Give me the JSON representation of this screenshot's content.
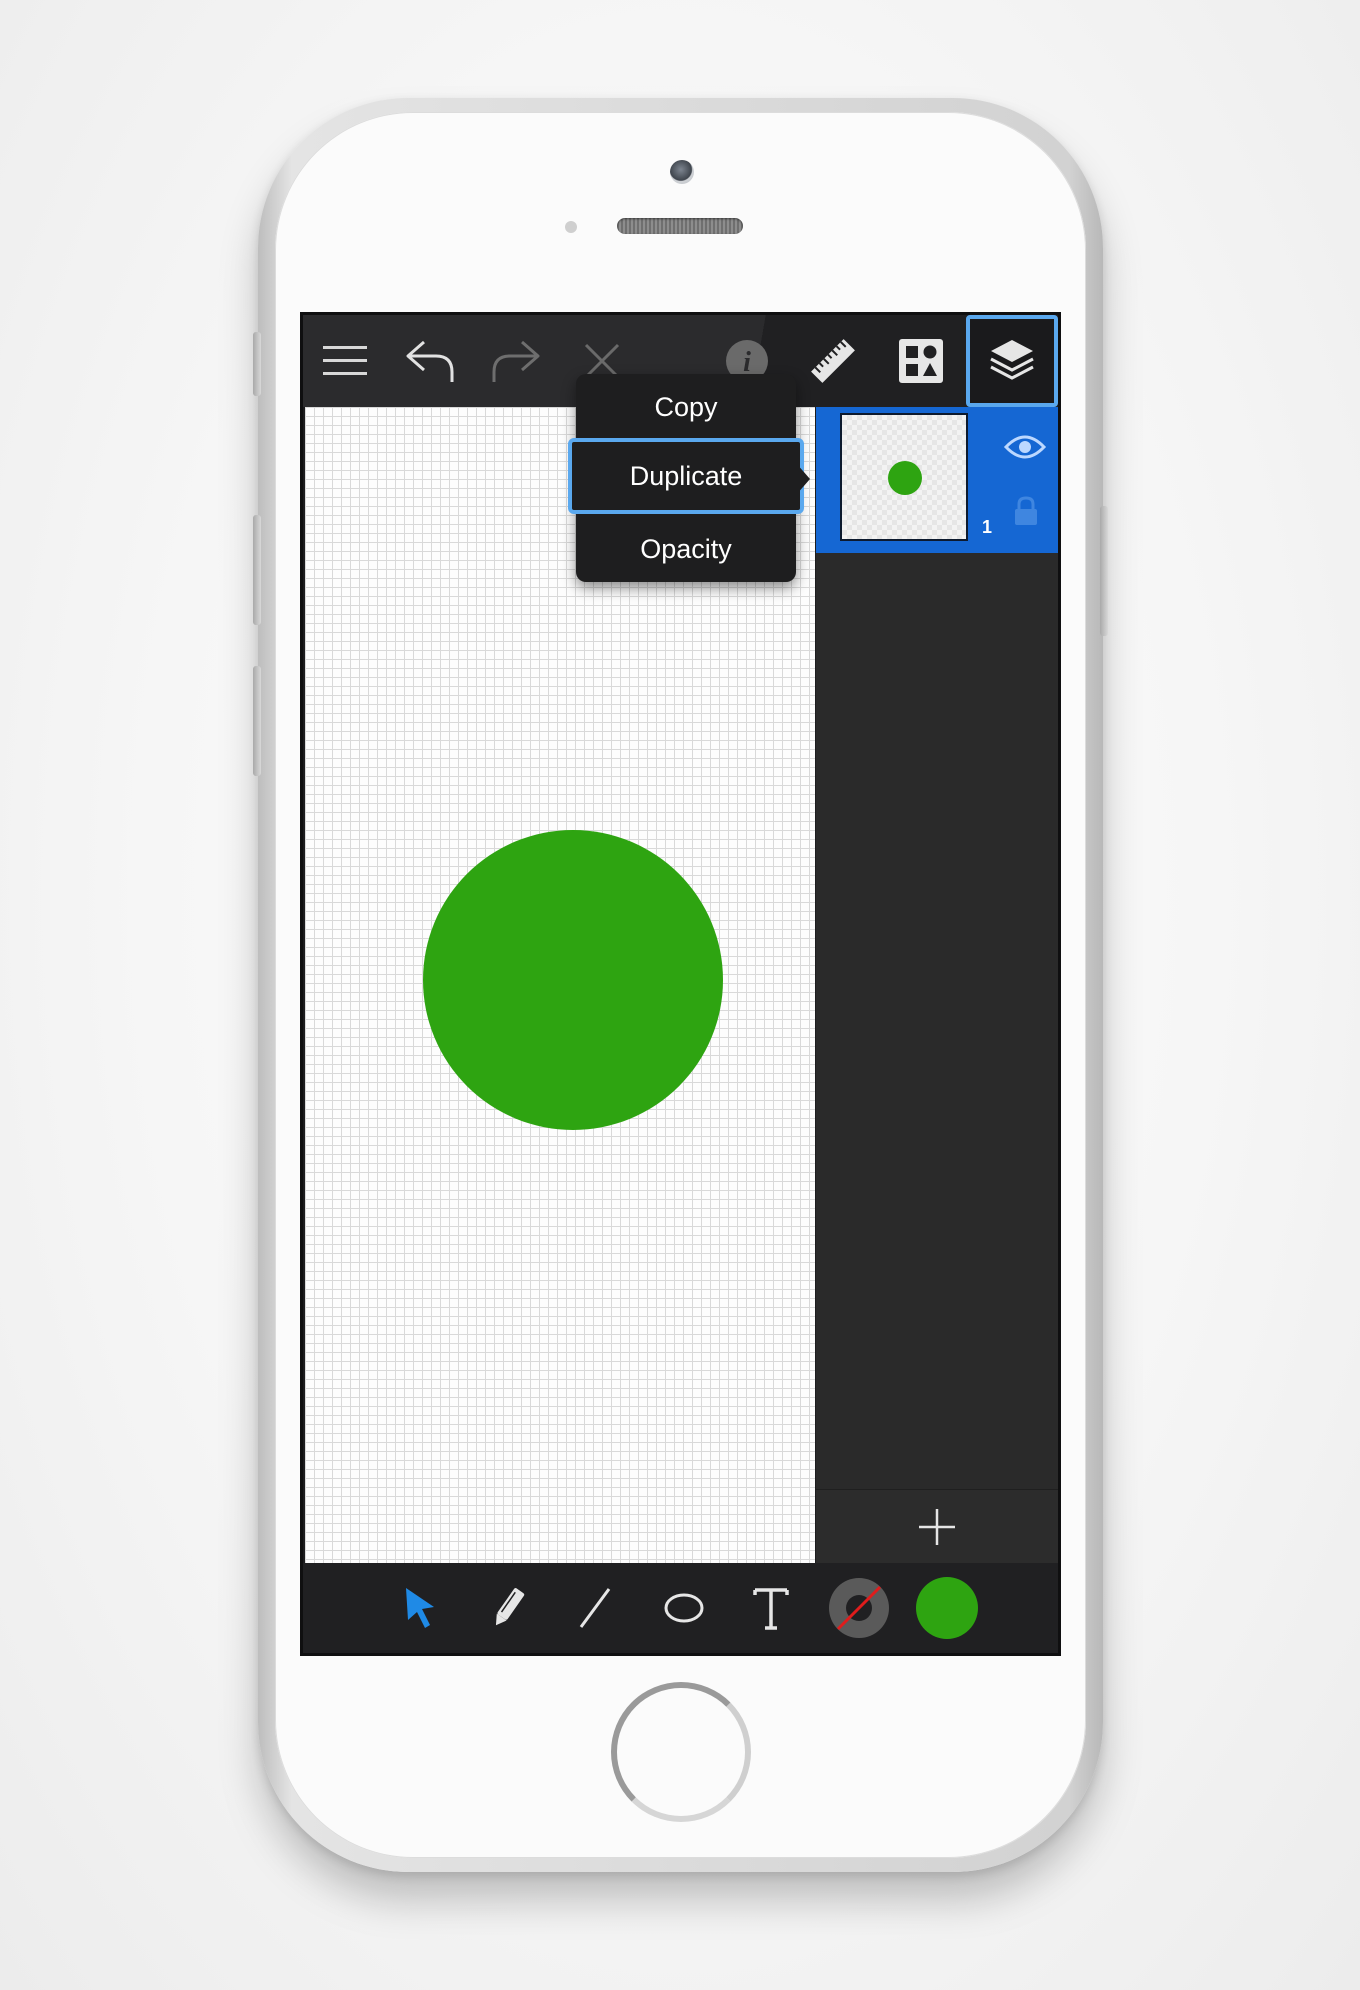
{
  "toolbar": {
    "buttons": [
      {
        "name": "menu",
        "icon": "hamburger-menu-icon"
      },
      {
        "name": "undo",
        "icon": "undo-arrow-icon"
      },
      {
        "name": "redo",
        "icon": "redo-arrow-icon",
        "disabled": true
      },
      {
        "name": "close",
        "icon": "close-x-icon",
        "disabled": true
      },
      {
        "name": "info",
        "icon": "info-icon",
        "disabled": true
      },
      {
        "name": "ruler",
        "icon": "ruler-icon"
      },
      {
        "name": "shapes-library",
        "icon": "shapes-library-icon"
      },
      {
        "name": "layers",
        "icon": "layers-icon",
        "active": true
      }
    ]
  },
  "context_menu": {
    "items": [
      "Copy",
      "Duplicate",
      "Opacity"
    ],
    "selected": "Duplicate"
  },
  "layers": {
    "items": [
      {
        "number": "1",
        "visible": true,
        "locked": false,
        "selected": true
      }
    ],
    "add_icon": "plus-icon"
  },
  "canvas": {
    "shape": "circle",
    "fill_color": "#2ea411"
  },
  "tools": {
    "items": [
      "select-arrow-icon",
      "pencil-icon",
      "line-icon",
      "ellipse-icon",
      "text-tool-icon",
      "stroke-color-icon",
      "fill-color-icon"
    ],
    "active": "select-arrow-icon",
    "fill_color": "#2ea411",
    "stroke_color": "#5a5a5a"
  },
  "colors": {
    "accent": "#1567d3",
    "highlight": "#5aa8ee",
    "active_tool": "#1f8ae6"
  }
}
